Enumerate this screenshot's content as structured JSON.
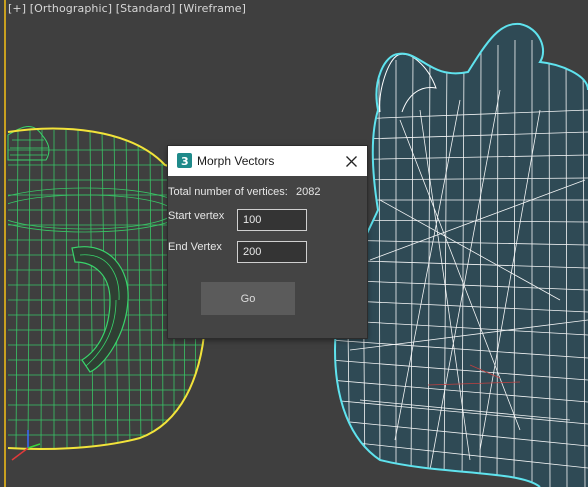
{
  "viewport": {
    "label": "[+] [Orthographic] [Standard] [Wireframe]",
    "colors": {
      "background": "#3f3f3f",
      "left_wire": "#39d46b",
      "left_outline": "#f2e33a",
      "right_wire": "#ffffff",
      "right_outline": "#5fe3ee",
      "right_fill": "#2f4a55"
    }
  },
  "dialog": {
    "icon": "3ds-max-app-icon",
    "title": "Morph Vectors",
    "close_icon": "close-icon",
    "total_label": "Total number of vertices:",
    "total_value": "2082",
    "start_label": "Start vertex",
    "start_value": "100",
    "end_label": "End Vertex",
    "end_value": "200",
    "go_label": "Go"
  }
}
